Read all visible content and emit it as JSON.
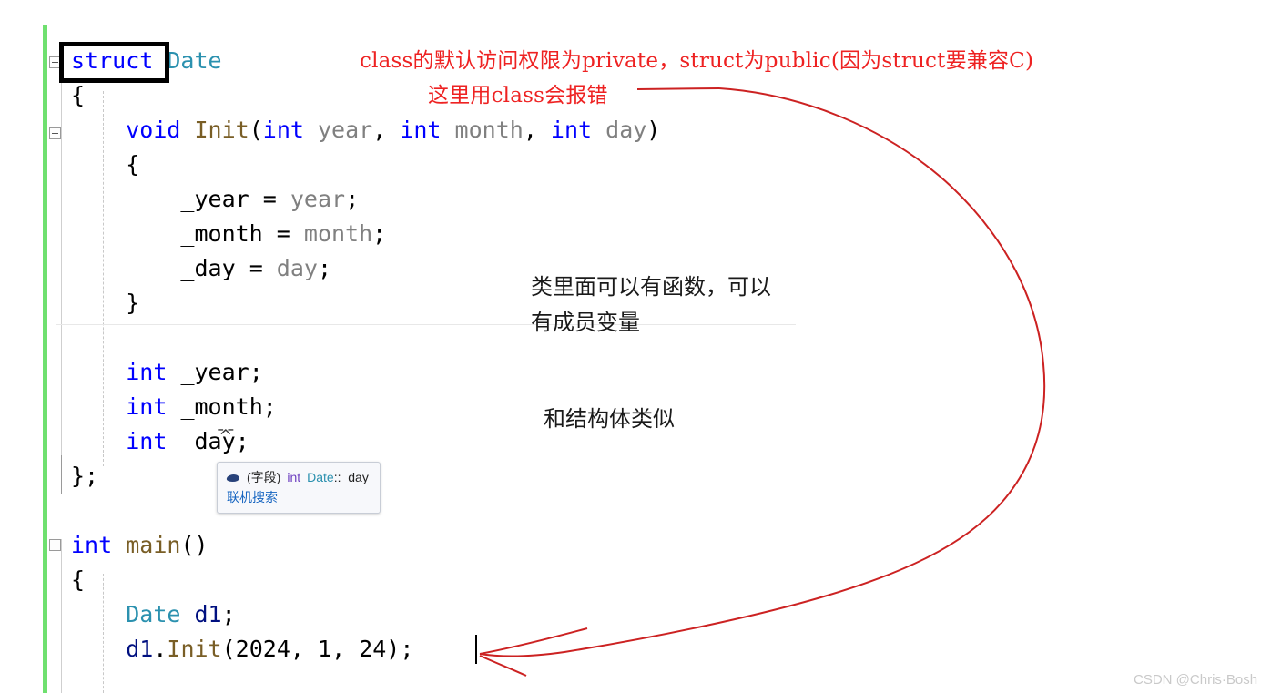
{
  "editor": {
    "language": "C++",
    "code_lines": [
      {
        "indent": 0,
        "tokens": [
          {
            "t": "struct",
            "c": "kw"
          },
          {
            "t": " ",
            "c": "plain"
          },
          {
            "t": "Date",
            "c": "type"
          }
        ]
      },
      {
        "indent": 0,
        "tokens": [
          {
            "t": "{",
            "c": "plain"
          }
        ]
      },
      {
        "indent": 1,
        "tokens": [
          {
            "t": "void",
            "c": "kw"
          },
          {
            "t": " ",
            "c": "plain"
          },
          {
            "t": "Init",
            "c": "fn"
          },
          {
            "t": "(",
            "c": "plain"
          },
          {
            "t": "int",
            "c": "kw"
          },
          {
            "t": " ",
            "c": "plain"
          },
          {
            "t": "year",
            "c": "param"
          },
          {
            "t": ", ",
            "c": "plain"
          },
          {
            "t": "int",
            "c": "kw"
          },
          {
            "t": " ",
            "c": "plain"
          },
          {
            "t": "month",
            "c": "param"
          },
          {
            "t": ", ",
            "c": "plain"
          },
          {
            "t": "int",
            "c": "kw"
          },
          {
            "t": " ",
            "c": "plain"
          },
          {
            "t": "day",
            "c": "param"
          },
          {
            "t": ")",
            "c": "plain"
          }
        ]
      },
      {
        "indent": 1,
        "tokens": [
          {
            "t": "{",
            "c": "plain"
          }
        ]
      },
      {
        "indent": 2,
        "tokens": [
          {
            "t": "_year",
            "c": "plain"
          },
          {
            "t": " = ",
            "c": "plain"
          },
          {
            "t": "year",
            "c": "param"
          },
          {
            "t": ";",
            "c": "plain"
          }
        ]
      },
      {
        "indent": 2,
        "tokens": [
          {
            "t": "_month",
            "c": "plain"
          },
          {
            "t": " = ",
            "c": "plain"
          },
          {
            "t": "month",
            "c": "param"
          },
          {
            "t": ";",
            "c": "plain"
          }
        ]
      },
      {
        "indent": 2,
        "tokens": [
          {
            "t": "_day",
            "c": "plain"
          },
          {
            "t": " = ",
            "c": "plain"
          },
          {
            "t": "day",
            "c": "param"
          },
          {
            "t": ";",
            "c": "plain"
          }
        ]
      },
      {
        "indent": 1,
        "tokens": [
          {
            "t": "}",
            "c": "plain"
          }
        ]
      },
      {
        "indent": 0,
        "tokens": []
      },
      {
        "indent": 1,
        "tokens": [
          {
            "t": "int",
            "c": "kw"
          },
          {
            "t": " ",
            "c": "plain"
          },
          {
            "t": "_year",
            "c": "plain"
          },
          {
            "t": ";",
            "c": "plain"
          }
        ]
      },
      {
        "indent": 1,
        "tokens": [
          {
            "t": "int",
            "c": "kw"
          },
          {
            "t": " ",
            "c": "plain"
          },
          {
            "t": "_month",
            "c": "plain"
          },
          {
            "t": ";",
            "c": "plain"
          }
        ]
      },
      {
        "indent": 1,
        "tokens": [
          {
            "t": "int",
            "c": "kw"
          },
          {
            "t": " ",
            "c": "plain"
          },
          {
            "t": "_day",
            "c": "plain"
          },
          {
            "t": ";",
            "c": "plain"
          }
        ]
      },
      {
        "indent": 0,
        "tokens": [
          {
            "t": "};",
            "c": "plain"
          }
        ]
      },
      {
        "indent": 0,
        "tokens": []
      },
      {
        "indent": 0,
        "tokens": [
          {
            "t": "int",
            "c": "kw"
          },
          {
            "t": " ",
            "c": "plain"
          },
          {
            "t": "main",
            "c": "fn"
          },
          {
            "t": "()",
            "c": "plain"
          }
        ]
      },
      {
        "indent": 0,
        "tokens": [
          {
            "t": "{",
            "c": "plain"
          }
        ]
      },
      {
        "indent": 1,
        "tokens": [
          {
            "t": "Date",
            "c": "type"
          },
          {
            "t": " ",
            "c": "plain"
          },
          {
            "t": "d1",
            "c": "var"
          },
          {
            "t": ";",
            "c": "plain"
          }
        ]
      },
      {
        "indent": 1,
        "tokens": [
          {
            "t": "d1",
            "c": "var"
          },
          {
            "t": ".",
            "c": "plain"
          },
          {
            "t": "Init",
            "c": "fn"
          },
          {
            "t": "(",
            "c": "plain"
          },
          {
            "t": "2024",
            "c": "num"
          },
          {
            "t": ", ",
            "c": "plain"
          },
          {
            "t": "1",
            "c": "num"
          },
          {
            "t": ", ",
            "c": "plain"
          },
          {
            "t": "24",
            "c": "num"
          },
          {
            "t": ");",
            "c": "plain"
          }
        ]
      }
    ],
    "highlight_box_text": "struct",
    "colors": {
      "keyword": "#0000ff",
      "type": "#2b91af",
      "function": "#795e26",
      "parameter": "#808080",
      "variable": "#001080",
      "change_bar": "#6fe06f",
      "annotation_red": "#ee2222",
      "background": "#ffffff"
    }
  },
  "tooltip": {
    "icon": "field-icon",
    "kind_label": "(字段)",
    "return_type": "int",
    "qualifier": "Date",
    "separator": "::",
    "member": "_day",
    "link_label": "联机搜索"
  },
  "annotations": {
    "red": [
      "class的默认访问权限为private，struct为public(因为struct要兼容C)",
      "这里用class会报错"
    ],
    "black": [
      "类里面可以有函数，可以",
      "有成员变量",
      "和结构体类似"
    ]
  },
  "watermark": "CSDN @Chris·Bosh"
}
